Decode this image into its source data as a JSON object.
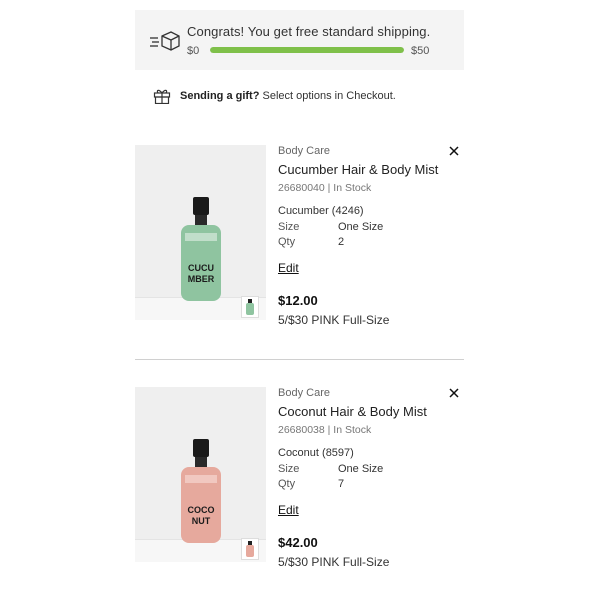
{
  "shipping": {
    "message": "Congrats! You get free standard shipping.",
    "min_label": "$0",
    "max_label": "$50",
    "progress": 1.0,
    "bar_color": "#7fc04a",
    "icon": "shipping-box-icon"
  },
  "gift": {
    "bold": "Sending a gift?",
    "rest": " Select options in Checkout.",
    "icon": "gift-icon"
  },
  "items": [
    {
      "category": "Body Care",
      "name": "Cucumber Hair & Body Mist",
      "sku_status": "26680040 | In Stock",
      "variant": "Cucumber (4246)",
      "size_label": "Size",
      "size_value": "One Size",
      "qty_label": "Qty",
      "qty_value": "2",
      "edit_label": "Edit",
      "price": "$12.00",
      "promo": "5/$30 PINK Full-Size",
      "bottle_label": "CUCU MBER",
      "bottle_color": "#8fc4a0"
    },
    {
      "category": "Body Care",
      "name": "Coconut Hair & Body Mist",
      "sku_status": "26680038 | In Stock",
      "variant": "Coconut (8597)",
      "size_label": "Size",
      "size_value": "One Size",
      "qty_label": "Qty",
      "qty_value": "7",
      "edit_label": "Edit",
      "price": "$42.00",
      "promo": "5/$30 PINK Full-Size",
      "bottle_label": "COCO NUT",
      "bottle_color": "#e6a99d"
    }
  ]
}
